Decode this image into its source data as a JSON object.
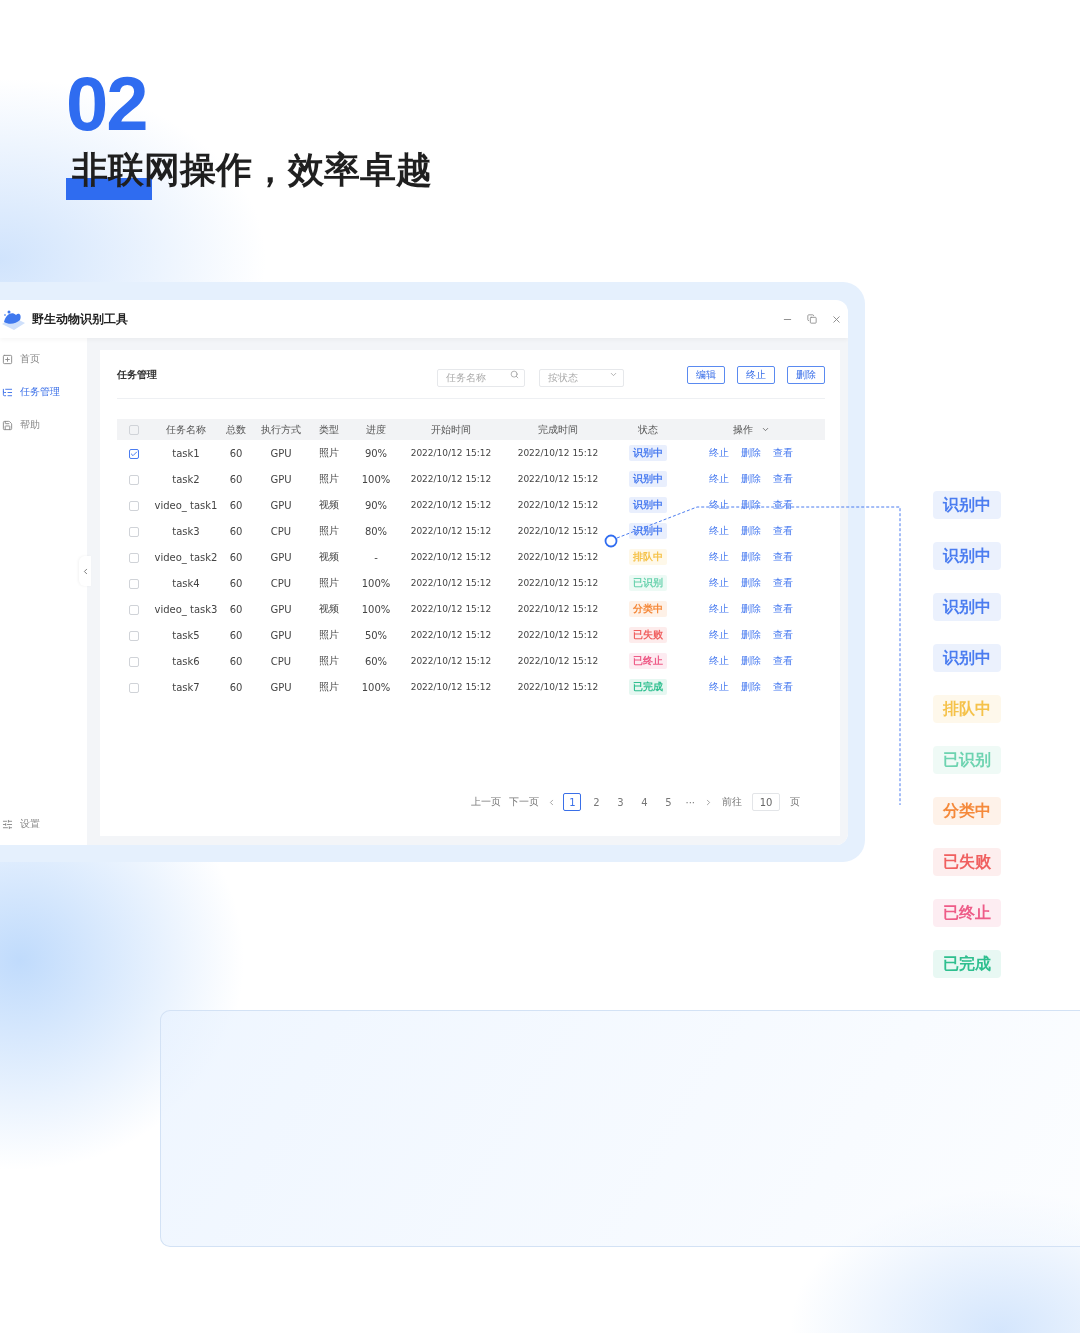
{
  "heading": {
    "number": "02",
    "title": "非联网操作，效率卓越"
  },
  "app": {
    "title": "野生动物识别工具",
    "sidebar": {
      "items": [
        {
          "label": "首页",
          "selected": false
        },
        {
          "label": "任务管理",
          "selected": true
        },
        {
          "label": "帮助",
          "selected": false
        }
      ],
      "footer": "设置"
    },
    "panel": {
      "title": "任务管理",
      "search": {
        "placeholder": "任务名称"
      },
      "filter": {
        "placeholder": "按状态"
      },
      "buttons": [
        "编辑",
        "终止",
        "删除"
      ]
    },
    "table": {
      "columns": [
        "任务名称",
        "总数",
        "执行方式",
        "类型",
        "进度",
        "开始时间",
        "完成时间",
        "状态",
        "操作"
      ],
      "header_checked": false,
      "rows": [
        {
          "checked": true,
          "name": "task1",
          "total": "60",
          "mode": "GPU",
          "type": "照片",
          "progress": "90%",
          "start": "2022/10/12 15:12",
          "end": "2022/10/12 15:12",
          "status": {
            "label": "识别中",
            "color": "#4a7cf0"
          },
          "actions": [
            "终止",
            "删除",
            "查看"
          ]
        },
        {
          "checked": false,
          "name": "task2",
          "total": "60",
          "mode": "GPU",
          "type": "照片",
          "progress": "100%",
          "start": "2022/10/12 15:12",
          "end": "2022/10/12 15:12",
          "status": {
            "label": "识别中",
            "color": "#4a7cf0"
          },
          "actions": [
            "终止",
            "删除",
            "查看"
          ]
        },
        {
          "checked": false,
          "name": "video_ task1",
          "total": "60",
          "mode": "GPU",
          "type": "视频",
          "progress": "90%",
          "start": "2022/10/12 15:12",
          "end": "2022/10/12 15:12",
          "status": {
            "label": "识别中",
            "color": "#4a7cf0"
          },
          "actions": [
            "终止",
            "删除",
            "查看"
          ]
        },
        {
          "checked": false,
          "name": "task3",
          "total": "60",
          "mode": "CPU",
          "type": "照片",
          "progress": "80%",
          "start": "2022/10/12 15:12",
          "end": "2022/10/12 15:12",
          "status": {
            "label": "识别中",
            "color": "#4a7cf0"
          },
          "actions": [
            "终止",
            "删除",
            "查看"
          ]
        },
        {
          "checked": false,
          "name": "video_ task2",
          "total": "60",
          "mode": "GPU",
          "type": "视频",
          "progress": "-",
          "start": "2022/10/12 15:12",
          "end": "2022/10/12 15:12",
          "status": {
            "label": "排队中",
            "color": "#f5c24a"
          },
          "actions": [
            "终止",
            "删除",
            "查看"
          ]
        },
        {
          "checked": false,
          "name": "task4",
          "total": "60",
          "mode": "CPU",
          "type": "照片",
          "progress": "100%",
          "start": "2022/10/12 15:12",
          "end": "2022/10/12 15:12",
          "status": {
            "label": "已识别",
            "color": "#6dd3b0"
          },
          "actions": [
            "终止",
            "删除",
            "查看"
          ]
        },
        {
          "checked": false,
          "name": "video_ task3",
          "total": "60",
          "mode": "GPU",
          "type": "视频",
          "progress": "100%",
          "start": "2022/10/12 15:12",
          "end": "2022/10/12 15:12",
          "status": {
            "label": "分类中",
            "color": "#f5893a"
          },
          "actions": [
            "终止",
            "删除",
            "查看"
          ]
        },
        {
          "checked": false,
          "name": "task5",
          "total": "60",
          "mode": "GPU",
          "type": "照片",
          "progress": "50%",
          "start": "2022/10/12 15:12",
          "end": "2022/10/12 15:12",
          "status": {
            "label": "已失败",
            "color": "#f06060"
          },
          "actions": [
            "终止",
            "删除",
            "查看"
          ]
        },
        {
          "checked": false,
          "name": "task6",
          "total": "60",
          "mode": "CPU",
          "type": "照片",
          "progress": "60%",
          "start": "2022/10/12 15:12",
          "end": "2022/10/12 15:12",
          "status": {
            "label": "已终止",
            "color": "#ee5c88"
          },
          "actions": [
            "终止",
            "删除",
            "查看"
          ]
        },
        {
          "checked": false,
          "name": "task7",
          "total": "60",
          "mode": "GPU",
          "type": "照片",
          "progress": "100%",
          "start": "2022/10/12 15:12",
          "end": "2022/10/12 15:12",
          "status": {
            "label": "已完成",
            "color": "#2fbf8f"
          },
          "actions": [
            "终止",
            "删除",
            "查看"
          ]
        }
      ]
    },
    "pagination": {
      "prev": "上一页",
      "next": "下一页",
      "pages": [
        {
          "label": "1",
          "selected": true
        },
        {
          "label": "2",
          "selected": false
        },
        {
          "label": "3",
          "selected": false
        },
        {
          "label": "4",
          "selected": false
        },
        {
          "label": "5",
          "selected": false
        }
      ],
      "ellipsis": "···",
      "goto": "前往",
      "page_input": "10",
      "page_unit": "页"
    }
  },
  "legend": [
    {
      "label": "识别中",
      "color": "#4a7cf0"
    },
    {
      "label": "识别中",
      "color": "#4a7cf0"
    },
    {
      "label": "识别中",
      "color": "#4a7cf0"
    },
    {
      "label": "识别中",
      "color": "#4a7cf0"
    },
    {
      "label": "排队中",
      "color": "#f5c24a"
    },
    {
      "label": "已识别",
      "color": "#6dd3b0"
    },
    {
      "label": "分类中",
      "color": "#f5893a"
    },
    {
      "label": "已失败",
      "color": "#f06060"
    },
    {
      "label": "已终止",
      "color": "#ee5c88"
    },
    {
      "label": "已完成",
      "color": "#2fbf8f"
    }
  ]
}
